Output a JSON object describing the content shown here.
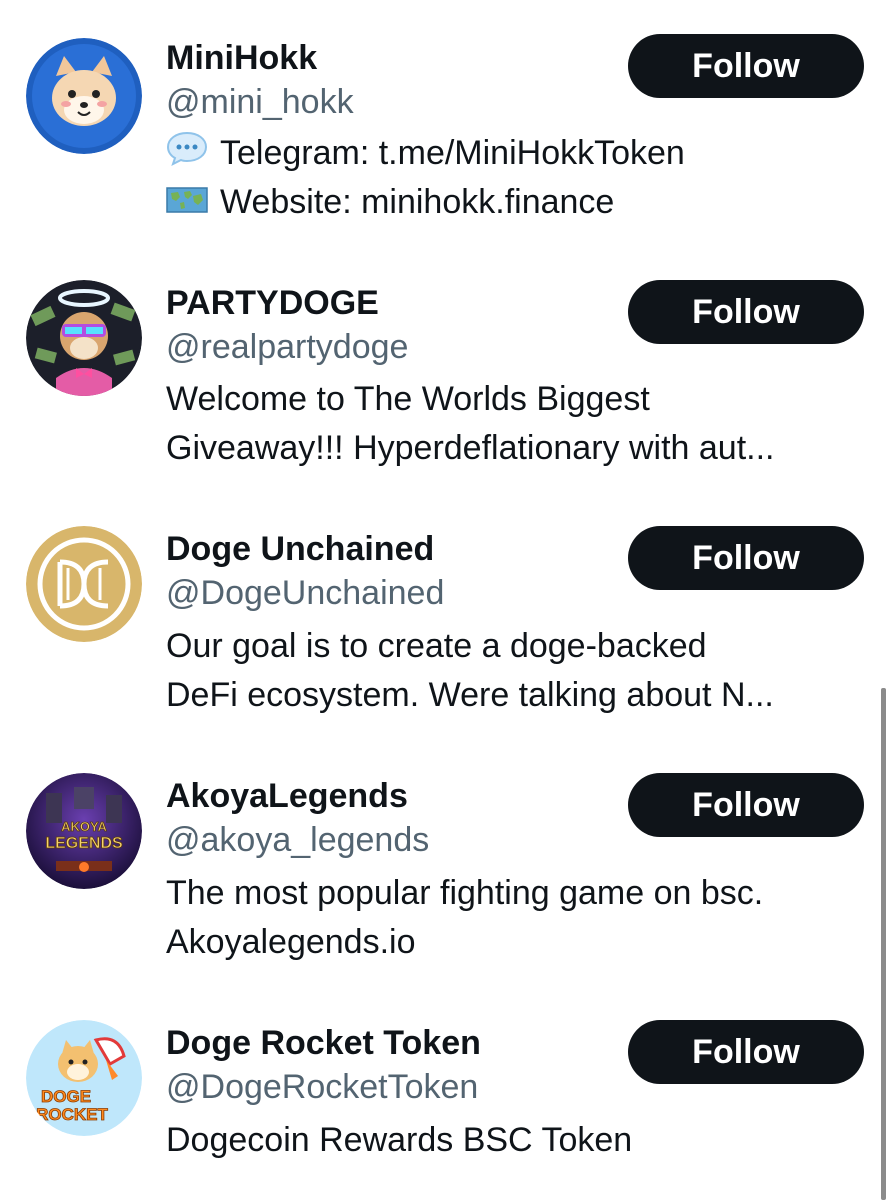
{
  "follow_label": "Follow",
  "accounts": [
    {
      "name": "MiniHokk",
      "handle": "@mini_hokk",
      "bio": [
        {
          "icon": "speech-bubble-icon",
          "text": "Telegram: t.me/MiniHokkToken"
        },
        {
          "icon": "world-map-icon",
          "text": "Website: minihokk.finance"
        }
      ]
    },
    {
      "name": "PARTYDOGE",
      "handle": "@realpartydoge",
      "bio": [
        {
          "text": "Welcome to The Worlds Biggest"
        },
        {
          "text": "Giveaway!!! Hyperdeflationary with aut..."
        }
      ]
    },
    {
      "name": "Doge Unchained",
      "handle": "@DogeUnchained",
      "bio": [
        {
          "text": "Our goal is to create a doge-backed"
        },
        {
          "text": "DeFi ecosystem. Were talking about N..."
        }
      ]
    },
    {
      "name": "AkoyaLegends",
      "handle": "@akoya_legends",
      "avatar_text": [
        "AKOYA",
        "LEGENDS"
      ],
      "bio": [
        {
          "text": "The most popular fighting game on bsc."
        },
        {
          "text": "Akoyalegends.io"
        }
      ]
    },
    {
      "name": "Doge Rocket Token",
      "handle": "@DogeRocketToken",
      "avatar_text": [
        "DOGE",
        "ROCKET"
      ],
      "bio": [
        {
          "text": "Dogecoin Rewards BSC Token"
        }
      ]
    }
  ],
  "colors": {
    "text_primary": "#0f1419",
    "text_secondary": "#536471",
    "follow_bg": "#0f1419",
    "follow_text": "#ffffff"
  }
}
